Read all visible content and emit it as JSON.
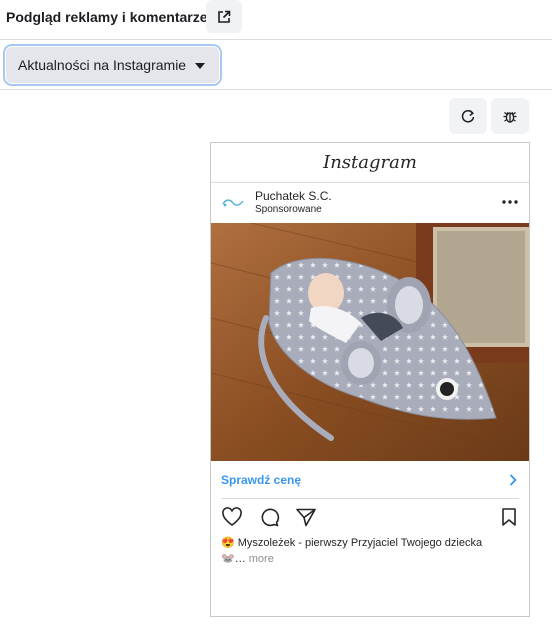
{
  "header": {
    "title": "Podgląd reklamy i komentarze",
    "external_icon": "external-link-icon"
  },
  "toolbar": {
    "placement_label": "Aktualności na Instagramie",
    "caret_icon": "caret-down-icon"
  },
  "tools": {
    "refresh_icon": "refresh-icon",
    "bug_icon": "bug-icon"
  },
  "preview": {
    "brand": "Instagram",
    "account_name": "Puchatek S.C.",
    "sponsored": "Sponsorowane",
    "cta_label": "Sprawdź cenę",
    "caption_line1": "😍 Myszoleżek - pierwszy Przyjaciel Twojego dziecka",
    "caption_line2_prefix": "🐭…",
    "caption_more": "more",
    "accent_color": "#3897f0"
  }
}
